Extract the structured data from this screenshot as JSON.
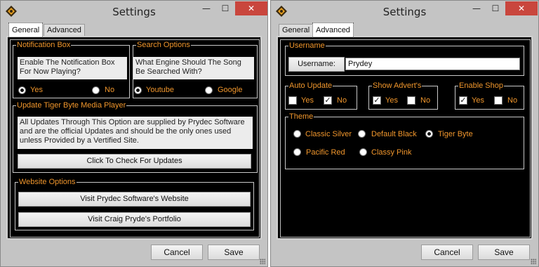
{
  "window_general": {
    "title": "Settings",
    "controls": {
      "minimize": "—",
      "maximize": "☐",
      "close": "✕"
    },
    "tabs": [
      {
        "label": "General",
        "active": true
      },
      {
        "label": "Advanced",
        "active": false
      }
    ],
    "notification_box": {
      "legend": "Notification Box",
      "question": "Enable The Notification Box For Now Playing?",
      "yes_label": "Yes",
      "no_label": "No",
      "selected": "Yes"
    },
    "search_options": {
      "legend": "Search Options",
      "question": "What Engine Should The Song Be Searched With?",
      "youtube_label": "Youtube",
      "google_label": "Google",
      "selected": "Youtube"
    },
    "update": {
      "legend": "Update Tiger Byte Media Player",
      "description": "All Updates Through This Option are supplied by Prydec Software and are the official Updates and should be the only ones used unless Provided by a Vertified Site.",
      "check_button": "Click To Check For Updates"
    },
    "website": {
      "legend": "Website Options",
      "prydec_button": "Visit Prydec Software's Website",
      "portfolio_button": "Visit Craig Pryde's Portfolio"
    },
    "cancel_label": "Cancel",
    "save_label": "Save"
  },
  "window_advanced": {
    "title": "Settings",
    "controls": {
      "minimize": "—",
      "maximize": "☐",
      "close": "✕"
    },
    "tabs": [
      {
        "label": "General",
        "active": false
      },
      {
        "label": "Advanced",
        "active": true
      }
    ],
    "username": {
      "legend": "Username",
      "button_label": "Username:",
      "value": "Prydey"
    },
    "auto_update": {
      "legend": "Auto Update",
      "yes_label": "Yes",
      "no_label": "No",
      "yes_checked": false,
      "no_checked": true
    },
    "show_adverts": {
      "legend": "Show Advert's",
      "yes_label": "Yes",
      "no_label": "No",
      "yes_checked": true,
      "no_checked": false
    },
    "enable_shop": {
      "legend": "Enable Shop",
      "yes_label": "Yes",
      "no_label": "No",
      "yes_checked": true,
      "no_checked": false
    },
    "theme": {
      "legend": "Theme",
      "options": [
        "Classic Silver",
        "Default Black",
        "Tiger Byte",
        "Pacific Red",
        "Classy Pink"
      ],
      "selected": "Tiger Byte"
    },
    "cancel_label": "Cancel",
    "save_label": "Save"
  },
  "colors": {
    "accent_orange": "#f0962c",
    "panel_black": "#000000",
    "close_red": "#c9463d"
  },
  "icons": {
    "app": "tiger-byte-app-icon"
  }
}
